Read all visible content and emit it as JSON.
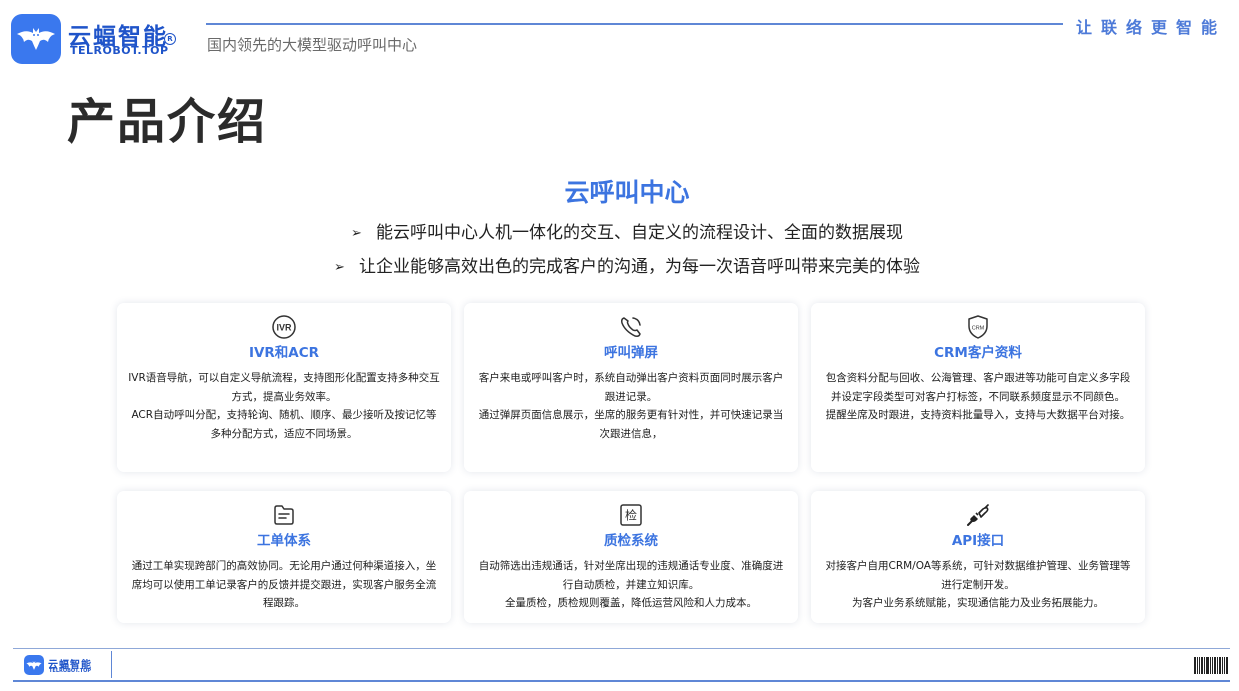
{
  "header": {
    "brand_name": "云蝠智能",
    "brand_reg": "R",
    "brand_domain": "TELROBOT.TOP",
    "subtitle": "国内领先的大模型驱动呼叫中心",
    "slogan": "让联络更智能",
    "logo_icon": "bat-logo-icon"
  },
  "page_title": "产品介绍",
  "intro": {
    "title": "云呼叫中心",
    "bullet_symbol": "➢",
    "bullets": [
      "能云呼叫中心人机一体化的交互、自定义的流程设计、全面的数据展现",
      "让企业能够高效出色的完成客户的沟通，为每一次语音呼叫带来完美的体验"
    ]
  },
  "cards": [
    {
      "icon": "ivr-icon",
      "icon_text": "IVR",
      "title": "IVR和ACR",
      "paragraphs": [
        "IVR语音导航，可以自定义导航流程，支持图形化配置支持多种交互方式，提高业务效率。",
        "ACR自动呼叫分配，支持轮询、随机、顺序、最少接听及按记忆等多种分配方式，适应不同场景。"
      ]
    },
    {
      "icon": "phone-icon",
      "title": "呼叫弹屏",
      "paragraphs": [
        "客户来电或呼叫客户时，系统自动弹出客户资料页面同时展示客户跟进记录。",
        "通过弹屏页面信息展示，坐席的服务更有针对性，并可快速记录当次跟进信息，"
      ]
    },
    {
      "icon": "crm-shield-icon",
      "icon_text": "CRM",
      "title": "CRM客户资料",
      "paragraphs": [
        "包含资料分配与回收、公海管理、客户跟进等功能可自定义多字段并设定字段类型可对客户打标签，不同联系频度显示不同颜色。",
        "提醒坐席及时跟进，支持资料批量导入，支持与大数据平台对接。"
      ]
    },
    {
      "icon": "folder-icon",
      "title": "工单体系",
      "paragraphs": [
        "通过工单实现跨部门的高效协同。无论用户通过何种渠道接入，坐席均可以使用工单记录客户的反馈并提交跟进，实现客户服务全流程跟踪。"
      ]
    },
    {
      "icon": "inspection-icon",
      "icon_text": "检",
      "title": "质检系统",
      "paragraphs": [
        "自动筛选出违规通话，针对坐席出现的违规通话专业度、准确度进行自动质检，并建立知识库。",
        "全量质检，质检规则覆盖，降低运营风险和人力成本。"
      ]
    },
    {
      "icon": "plug-icon",
      "title": "API接口",
      "paragraphs": [
        "对接客户自用CRM/OA等系统，可针对数据维护管理、业务管理等进行定制开发。",
        "为客户业务系统赋能，实现通信能力及业务拓展能力。"
      ]
    }
  ],
  "footer": {
    "brand_name": "云蝠智能",
    "brand_domain": "TELROBOT.TOP",
    "barcode_icon": "barcode-icon"
  },
  "colors": {
    "brand_blue": "#3a78ee",
    "title_blue": "#3c74e0",
    "dark_blue": "#1f54c9"
  }
}
